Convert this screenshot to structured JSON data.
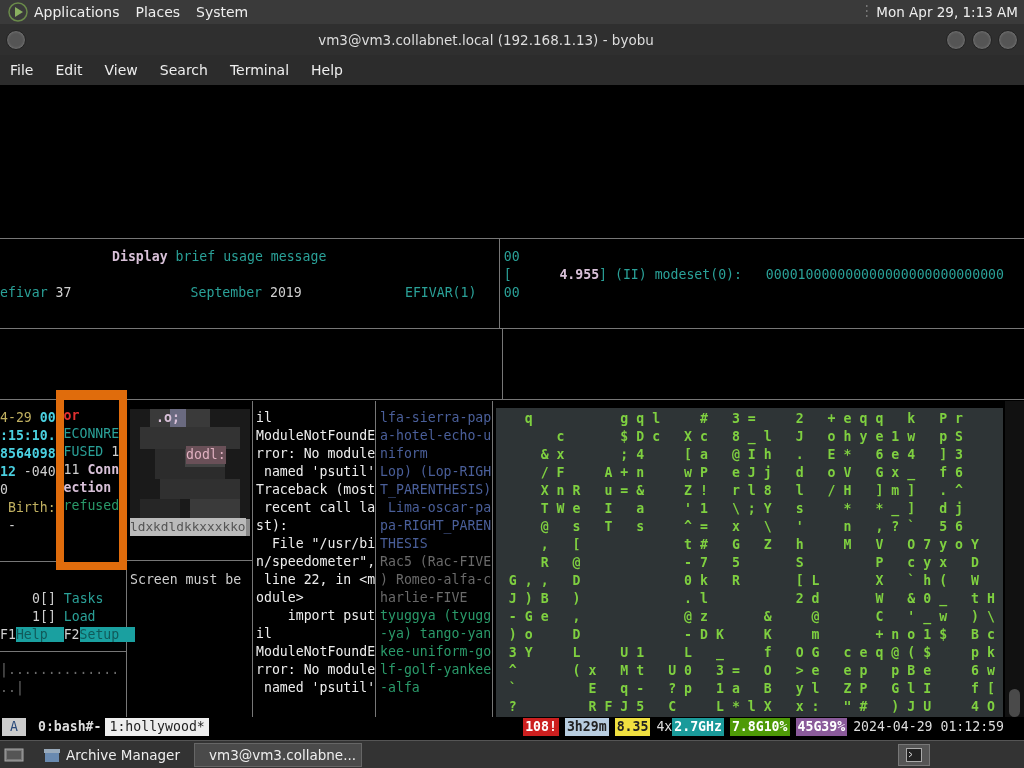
{
  "top_panel": {
    "menus": [
      "Applications",
      "Places",
      "System"
    ],
    "clock": "Mon Apr 29, 1:13 AM"
  },
  "window": {
    "title": "vm3@vm3.collabnet.local (192.168.1.13) - byobu",
    "menu": [
      "File",
      "Edit",
      "View",
      "Search",
      "Terminal",
      "Help"
    ]
  },
  "manual": {
    "lines": [
      [
        {
          "text": "Display",
          "kind": "bold"
        },
        {
          "text": " brief usage message",
          "kind": "teal"
        }
      ],
      [
        {
          "text": "efivar",
          "kind": "teal"
        },
        {
          "text": " 37               ",
          "kind": "plain"
        },
        {
          "text": "September",
          "kind": "teal"
        },
        {
          "text": " 2019             ",
          "kind": "plain"
        },
        {
          "text": "EFIVAR(1)",
          "kind": "teal"
        }
      ]
    ]
  },
  "kernel_log": {
    "lines": [
      [
        {
          "text": "00",
          "kind": "teal"
        }
      ],
      [
        {
          "text": "[      ",
          "kind": "teal"
        },
        {
          "text": "4.955",
          "kind": "bold"
        },
        {
          "text": "] (II) modeset(0):   000010000000000000000000000000",
          "kind": "teal"
        }
      ],
      [
        {
          "text": "00",
          "kind": "teal"
        }
      ]
    ]
  },
  "stat": {
    "lines": [
      [
        {
          "text": "4-29 ",
          "kind": "yellow"
        },
        {
          "text": "00",
          "kind": "cyan"
        }
      ],
      [
        {
          "text": ":15:10.",
          "kind": "cyan"
        }
      ],
      [
        {
          "text": "8564098",
          "kind": "cyan"
        }
      ],
      [
        {
          "text": "12",
          "kind": "cyan"
        },
        {
          "text": " -040",
          "kind": "plain"
        }
      ],
      [
        {
          "text": "0",
          "kind": "plain"
        }
      ],
      [
        {
          "text": " Birth:",
          "kind": "yellow"
        }
      ],
      [
        {
          "text": " -",
          "kind": "plain"
        }
      ]
    ]
  },
  "error_box": {
    "lines": [
      [
        {
          "text": "or",
          "kind": "red"
        }
      ],
      [
        {
          "text": "ECONNRE",
          "kind": "teal"
        }
      ],
      [
        {
          "text": "FUSED",
          "kind": "teal"
        },
        {
          "text": " 1",
          "kind": "plain"
        }
      ],
      [
        {
          "text": "11 ",
          "kind": "plain"
        },
        {
          "text": "Conn",
          "kind": "bold"
        }
      ],
      [
        {
          "text": "ection",
          "kind": "bold"
        }
      ],
      [
        {
          "text": "refused",
          "kind": "green"
        }
      ]
    ]
  },
  "ascii_art": {
    "lines": [
      ".o;",
      "dodl:",
      "ldxkdldkkxxxkko"
    ]
  },
  "htop": {
    "meters": [
      {
        "index": "0[]",
        "label": "Tasks"
      },
      {
        "index": "1[]",
        "label": "Load"
      }
    ],
    "keys": [
      {
        "key": "F1",
        "action": "Help"
      },
      {
        "key": "F2",
        "action": "Setup"
      }
    ]
  },
  "progress": {
    "lines": [
      "|..............",
      "..|"
    ]
  },
  "screen_message": "Screen must be",
  "traceback": {
    "lines": [
      "il",
      "ModuleNotFoundE",
      "rror: No module",
      " named 'psutil'",
      "Traceback (most",
      " recent call la",
      "st):",
      "  File \"/usr/bi",
      "n/speedometer\",",
      " line 22, in <m",
      "odule>",
      "    import psut",
      "il",
      "ModuleNotFoundE",
      "rror: No module",
      " named 'psutil'"
    ]
  },
  "phonetic": {
    "lines": [
      {
        "text": "lfa-sierra-pap",
        "kind": "blue"
      },
      {
        "text": "a-hotel-echo-u",
        "kind": "blue"
      },
      {
        "text": "niform",
        "kind": "blue"
      },
      {
        "text": "Lop) (Lop-RIGH",
        "kind": "blue"
      },
      {
        "text": "T_PARENTHESIS)",
        "kind": "blue"
      },
      {
        "text": " Lima-oscar-pa",
        "kind": "blue"
      },
      {
        "text": "pa-RIGHT_PAREN",
        "kind": "blue"
      },
      {
        "text": "THESIS",
        "kind": "blue"
      },
      {
        "text": "Rac5 (Rac-FIVE",
        "kind": "gray"
      },
      {
        "text": ") Romeo-alfa-c",
        "kind": "gray"
      },
      {
        "text": "harlie-FIVE",
        "kind": "gray"
      },
      {
        "text": "tyuggya (tyugg",
        "kind": "green"
      },
      {
        "text": "-ya) tango-yan",
        "kind": "green"
      },
      {
        "text": "kee-uniform-go",
        "kind": "green"
      },
      {
        "text": "lf-golf-yankee",
        "kind": "green"
      },
      {
        "text": "-alfa",
        "kind": "green"
      }
    ]
  },
  "matrix": {
    "rows": [
      " q     gql  # 3=  2 +eqq k Pr",
      "   c   $Dc Xc 8_l J ohye1w pS",
      "  &x   ;4  [a @Ih . E* 6e4 ]3",
      "  /F  A+n  wP eJj d oV Gx_ f6",
      "  XnR u=&  Z! rl8 l /H ]m] .^",
      "  TWe I a  '1 \\;Y s  * *_] dj",
      "  @ s T s  ^= x \\ '  n ,?` 56",
      "  , [      t# G Z h  M V O7yoY",
      "  R @      -7 5   S    P cyx D",
      "G,, D      0k R   [L   X `h( W",
      "J)B )      .l     2d   W &0_ tH",
      "-Ge ,      @z   &  @   C '_w )\\",
      ")o  D      -DK  K  m   +no1$ Bc",
      "3Y  L  U1  L _  f OG ceq@($  pk",
      "^   (x Mt U0 3= O >e ep pBe  6w",
      "`    E q- ?p 1a B yl ZP GlI  f[",
      "?    RFJ5 C  L*lX x: \"# )JU  4O"
    ]
  },
  "status_bar": {
    "session": "A",
    "windows": [
      {
        "label": "0:bash#-",
        "selected": false
      },
      {
        "label": "1:hollywood*",
        "selected": true
      }
    ],
    "widgets": [
      {
        "text": "108!",
        "color": "#cc1f1f"
      },
      {
        "text": "3h29m",
        "color": "#b8cde0"
      },
      {
        "text": "8.35",
        "color": "#f0e040"
      },
      {
        "text": "4x"
      },
      {
        "text": "2.7GHz",
        "color": "#1a9a9a"
      },
      {
        "text": "7.8G10%",
        "color": "#4e9a06"
      },
      {
        "text": "45G39%",
        "color": "#8a5a9a"
      }
    ],
    "datetime": "2024-04-29 01:12:59"
  },
  "taskbar": {
    "items": [
      {
        "label": "Archive Manager",
        "selected": false,
        "kind": "archive"
      },
      {
        "label": "vm3@vm3.collabne...",
        "selected": true,
        "kind": "terminal"
      }
    ]
  }
}
